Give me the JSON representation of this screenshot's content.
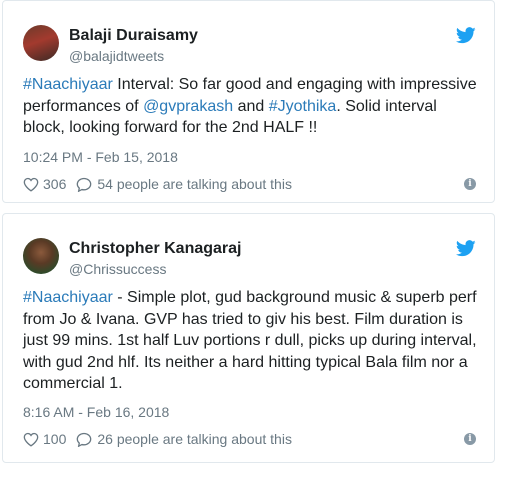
{
  "colors": {
    "link": "#2b7bb9",
    "muted": "#697882",
    "twitter_blue": "#1da1f2",
    "text": "#1c2022"
  },
  "tweets": [
    {
      "name": "Balaji Duraisamy",
      "handle": "@balajidtweets",
      "segments": [
        {
          "text": "#Naachiyaar",
          "link": true
        },
        {
          "text": " Interval: So far good and engaging with impressive performances of ",
          "link": false
        },
        {
          "text": "@gvprakash",
          "link": true
        },
        {
          "text": " and ",
          "link": false
        },
        {
          "text": "#Jyothika",
          "link": true
        },
        {
          "text": ". Solid interval block, looking forward for the 2nd HALF !!",
          "link": false
        }
      ],
      "timestamp": "10:24 PM - Feb 15, 2018",
      "likes": "306",
      "talking": "54 people are talking about this",
      "icons": [
        "avatar",
        "twitter-bird-icon",
        "heart-icon",
        "comment-icon",
        "info-icon"
      ]
    },
    {
      "name": "Christopher Kanagaraj",
      "handle": "@Chrissuccess",
      "segments": [
        {
          "text": "#Naachiyaar",
          "link": true
        },
        {
          "text": " - Simple plot, gud background music & superb perf from Jo & Ivana. GVP has tried to giv his best. Film duration is just 99 mins. 1st half Luv portions r dull, picks up during interval, with gud 2nd hlf. Its neither a hard hitting typical Bala film nor a commercial 1.",
          "link": false
        }
      ],
      "timestamp": "8:16 AM - Feb 16, 2018",
      "likes": "100",
      "talking": "26 people are talking about this",
      "icons": [
        "avatar",
        "twitter-bird-icon",
        "heart-icon",
        "comment-icon",
        "info-icon"
      ]
    }
  ]
}
